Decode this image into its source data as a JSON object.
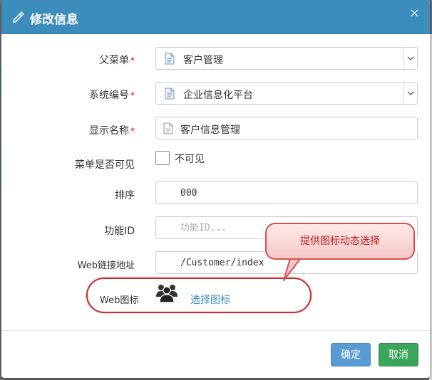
{
  "dialog": {
    "title": "修改信息",
    "close_glyph": "×"
  },
  "form": {
    "parent_menu": {
      "label": "父菜单",
      "value": "客户管理",
      "required_mark": "*"
    },
    "system_code": {
      "label": "系统编号",
      "value": "企业信息化平台",
      "required_mark": "*"
    },
    "display_name": {
      "label": "显示名称",
      "value": "客户信息管理",
      "required_mark": "*"
    },
    "menu_visible": {
      "label": "菜单是否可见",
      "option_label": "不可见",
      "checked": false
    },
    "sort": {
      "label": "排序",
      "value": "000"
    },
    "function_id": {
      "label": "功能ID",
      "placeholder": "功能ID..."
    },
    "web_url": {
      "label": "Web链接地址",
      "value": "/Customer/index"
    },
    "web_icon": {
      "label": "Web图标",
      "icon": "users-icon",
      "choose_label": "选择图标"
    }
  },
  "annotation": {
    "callout_text": "提供图标动态选择",
    "highlight_color": "#c0312f"
  },
  "footer": {
    "confirm_label": "确定",
    "cancel_label": "取消"
  },
  "colors": {
    "header": "#3c8dbc",
    "confirm": "#5b9bd5",
    "cancel": "#3ca55c",
    "required": "#dd0000"
  }
}
